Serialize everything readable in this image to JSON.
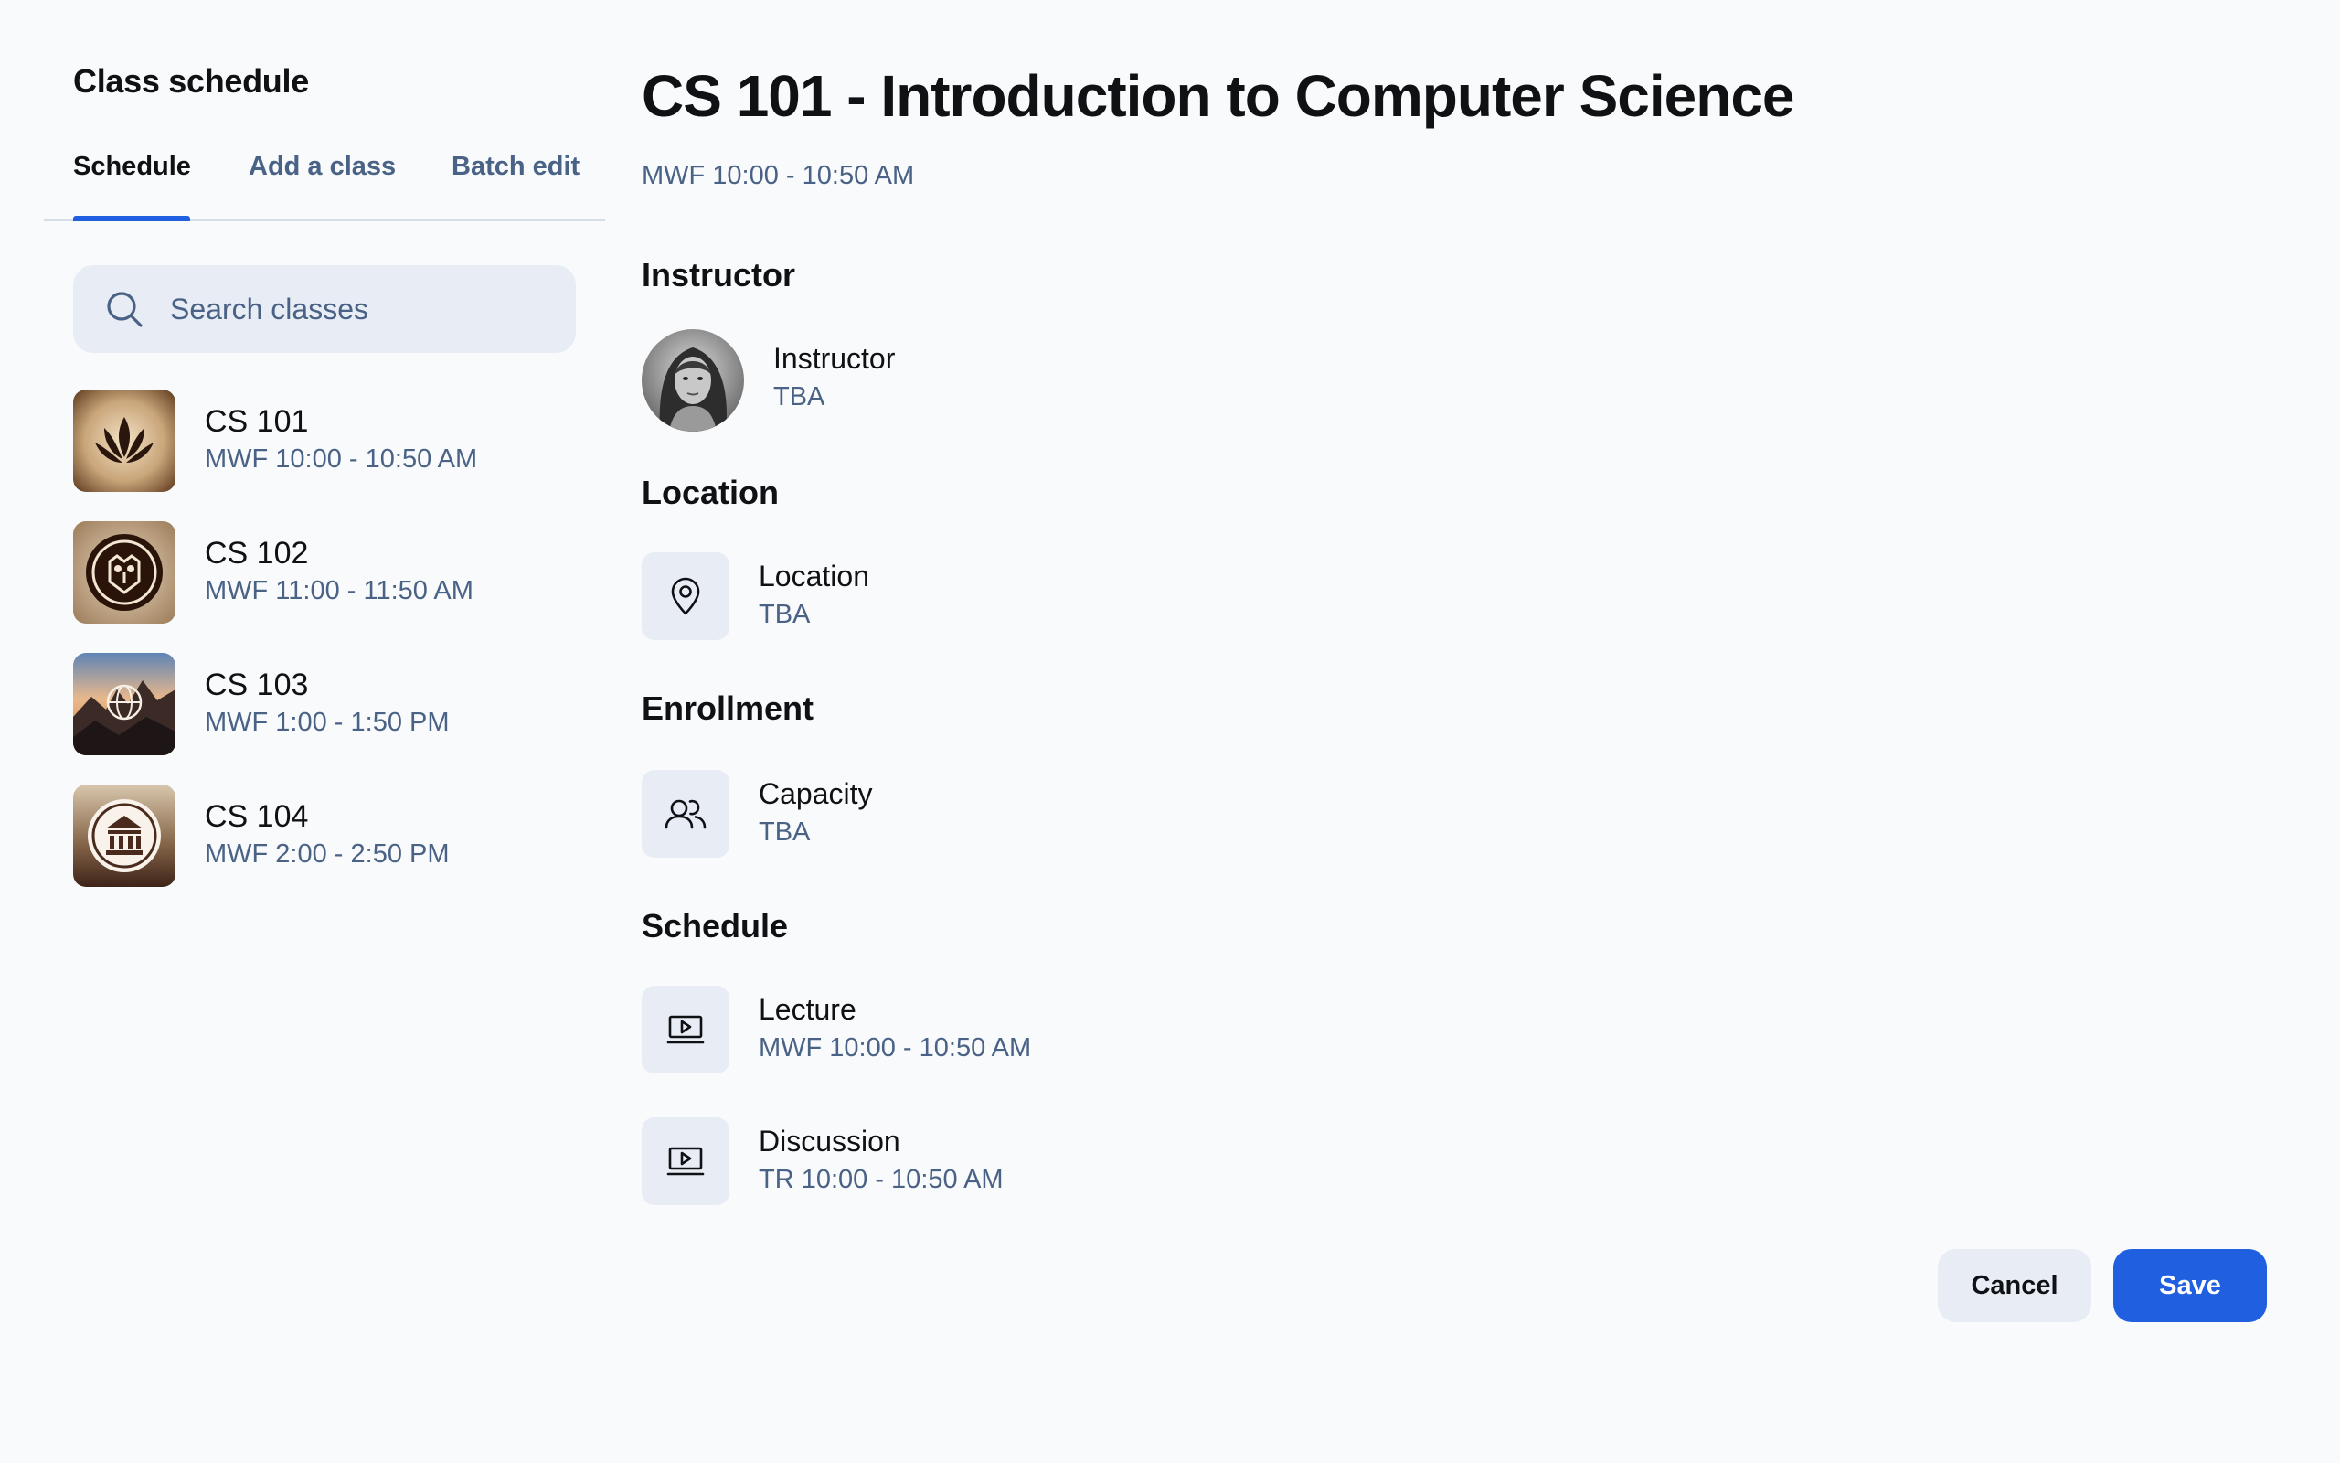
{
  "sidebar": {
    "title": "Class schedule",
    "tabs": [
      {
        "label": "Schedule",
        "active": true
      },
      {
        "label": "Add a class",
        "active": false
      },
      {
        "label": "Batch edit",
        "active": false
      }
    ],
    "search": {
      "placeholder": "Search classes",
      "value": ""
    },
    "classes": [
      {
        "code": "CS 101",
        "time": "MWF 10:00 - 10:50 AM",
        "icon": "lotus-emblem-icon"
      },
      {
        "code": "CS 102",
        "time": "MWF 11:00 - 11:50 AM",
        "icon": "owl-crest-icon"
      },
      {
        "code": "CS 103",
        "time": "MWF 1:00 - 1:50 PM",
        "icon": "globe-landscape-icon"
      },
      {
        "code": "CS 104",
        "time": "MWF 2:00 - 2:50 PM",
        "icon": "building-seal-icon"
      }
    ]
  },
  "detail": {
    "title": "CS 101 - Introduction to Computer Science",
    "subtitle": "MWF 10:00 - 10:50 AM",
    "instructor": {
      "heading": "Instructor",
      "label": "Instructor",
      "value": "TBA",
      "icon": "avatar"
    },
    "location": {
      "heading": "Location",
      "label": "Location",
      "value": "TBA",
      "icon": "map-pin-icon"
    },
    "enrollment": {
      "heading": "Enrollment",
      "label": "Capacity",
      "value": "TBA",
      "icon": "users-icon"
    },
    "schedule": {
      "heading": "Schedule",
      "items": [
        {
          "label": "Lecture",
          "value": "MWF 10:00 - 10:50 AM",
          "icon": "video-screen-icon"
        },
        {
          "label": "Discussion",
          "value": "TR 10:00 - 10:50 AM",
          "icon": "video-screen-icon"
        }
      ]
    }
  },
  "actions": {
    "cancel_label": "Cancel",
    "save_label": "Save"
  },
  "colors": {
    "accent": "#1f5fe0",
    "muted_text": "#4a6285",
    "tile_bg": "#e8ecf4",
    "background": "#f8fafc"
  }
}
